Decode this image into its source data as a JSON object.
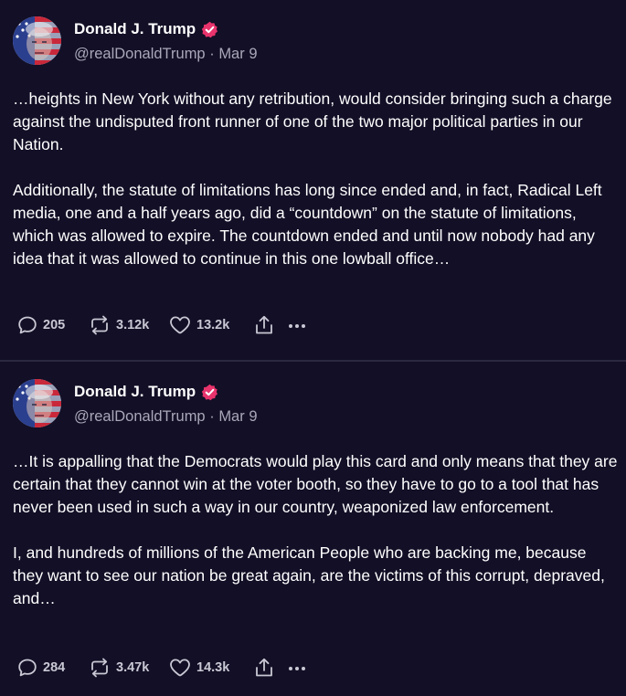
{
  "posts": [
    {
      "author_name": "Donald J. Trump",
      "handle": "@realDonaldTrump",
      "separator": "·",
      "date": "Mar 9",
      "paragraphs": [
        "…heights in New York without any retribution, would consider bringing such a charge against the undisputed front runner of one of the two major political parties in our Nation.",
        "Additionally, the statute of limitations has long since ended and, in fact, Radical Left media, one and a half years ago, did a “countdown” on the statute of limitations, which was allowed to expire. The countdown ended and until now nobody had any idea that it was allowed to continue in this one lowball office…"
      ],
      "replies": "205",
      "reposts": "3.12k",
      "likes": "13.2k"
    },
    {
      "author_name": "Donald J. Trump",
      "handle": "@realDonaldTrump",
      "separator": "·",
      "date": "Mar 9",
      "paragraphs": [
        "…It is appalling that the Democrats would play this card and only means that they are certain that they cannot win at the voter booth, so they have to go to a tool that has never been used in such a way in our country, weaponized law enforcement.",
        "I, and hundreds of millions of the American People who are backing me, because they want to see our nation be great again, are the victims of this corrupt, depraved, and…"
      ],
      "replies": "284",
      "reposts": "3.47k",
      "likes": "14.3k"
    }
  ],
  "icons": {
    "reply": "speech-bubble-icon",
    "repost": "repost-arrows-icon",
    "like": "heart-icon",
    "share": "share-upload-icon",
    "more": "more-dots-icon",
    "verified": "verified-badge-icon"
  },
  "colors": {
    "background": "#120f26",
    "verified_badge": "#e8336c",
    "secondary_text": "#a9a7b8",
    "action_text": "#c9c8d4"
  }
}
